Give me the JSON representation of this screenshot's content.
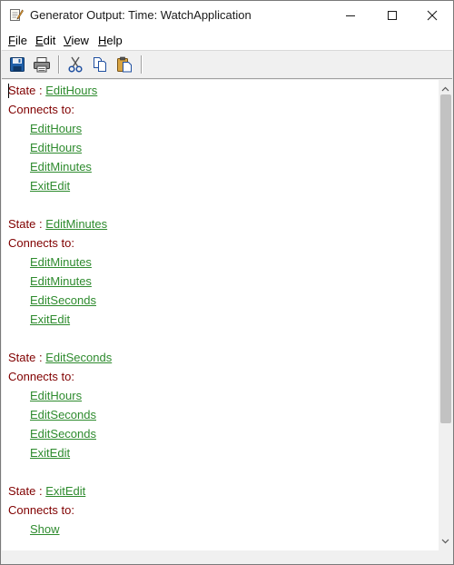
{
  "window": {
    "title": "Generator Output: Time: WatchApplication"
  },
  "menu": [
    {
      "accel": "F",
      "rest": "ile"
    },
    {
      "accel": "E",
      "rest": "dit"
    },
    {
      "accel": "V",
      "rest": "iew"
    },
    {
      "accel": "H",
      "rest": "elp"
    }
  ],
  "content": {
    "state_label": "State",
    "separator": " : ",
    "connects_label": "Connects to:",
    "states": [
      {
        "name": "EditHours",
        "targets": [
          "EditHours",
          "EditHours",
          "EditMinutes",
          "ExitEdit"
        ]
      },
      {
        "name": "EditMinutes",
        "targets": [
          "EditMinutes",
          "EditMinutes",
          "EditSeconds",
          "ExitEdit"
        ]
      },
      {
        "name": "EditSeconds",
        "targets": [
          "EditHours",
          "EditSeconds",
          "EditSeconds",
          "ExitEdit"
        ]
      },
      {
        "name": "ExitEdit",
        "targets": [
          "Show"
        ]
      }
    ]
  },
  "colors": {
    "label": "#800000",
    "link": "#2e8b2e",
    "scroll_thumb": "#c2c2c2"
  },
  "icons": [
    "notepad-icon",
    "save-icon",
    "print-icon",
    "cut-icon",
    "copy-icon",
    "paste-icon"
  ]
}
